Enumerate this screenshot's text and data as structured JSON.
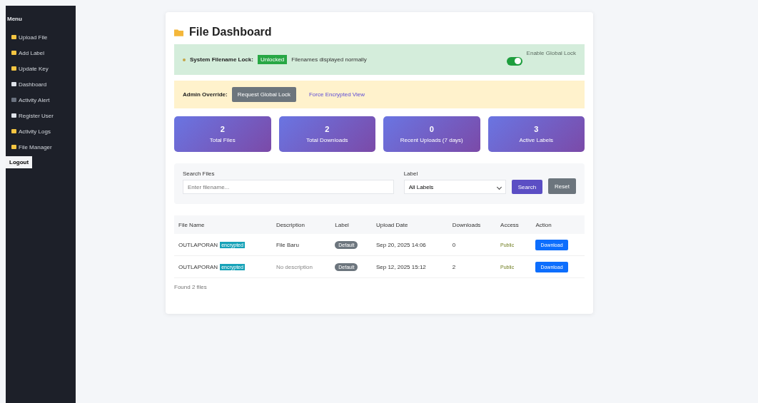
{
  "sidebar": {
    "heading": "Menu",
    "items": [
      {
        "label": "Upload File",
        "color": "#f4c542"
      },
      {
        "label": "Add Label",
        "color": "#f4c542"
      },
      {
        "label": "Update Key",
        "color": "#f4c542"
      },
      {
        "label": "Dashboard",
        "color": "#dfe3ea"
      },
      {
        "label": "Activity Alert",
        "color": "#6b7280"
      },
      {
        "label": "Register User",
        "color": "#dfe3ea"
      },
      {
        "label": "Activity Logs",
        "color": "#f4c542"
      },
      {
        "label": "File Manager",
        "color": "#f4c542"
      }
    ],
    "logout": "Logout"
  },
  "title": "File Dashboard",
  "lock_panel": {
    "label": "System Filename Lock:",
    "badge": "Unlocked",
    "status": "Filenames displayed normally",
    "toggle": {
      "on": true,
      "label": "Enable Global Lock"
    }
  },
  "admin_panel": {
    "label": "Admin Override:",
    "button": "Request Global Lock",
    "link": "Force Encrypted View"
  },
  "stats": [
    {
      "value": "2",
      "label": "Total Files"
    },
    {
      "value": "2",
      "label": "Total Downloads"
    },
    {
      "value": "0",
      "label": "Recent Uploads (7 days)"
    },
    {
      "value": "3",
      "label": "Active Labels"
    }
  ],
  "filters": {
    "search_label": "Search Files",
    "search_placeholder": "Enter filename...",
    "label_label": "Label",
    "label_value": "All Labels",
    "search_button": "Search",
    "reset_button": "Reset"
  },
  "table": {
    "columns": [
      "File Name",
      "Description",
      "Label",
      "Upload Date",
      "Downloads",
      "Access",
      "Action"
    ],
    "rows": [
      {
        "name": "OUTLAPORAN",
        "badge": "encrypted",
        "description": "File Baru",
        "description_muted": false,
        "label": "Default",
        "date": "Sep 20, 2025 14:06",
        "downloads": "0",
        "access": "Public",
        "action": "Download"
      },
      {
        "name": "OUTLAPORAN",
        "badge": "encrypted",
        "description": "No description",
        "description_muted": true,
        "label": "Default",
        "date": "Sep 12, 2025 15:12",
        "downloads": "2",
        "access": "Public",
        "action": "Download"
      }
    ]
  },
  "footer": "Found 2 files"
}
